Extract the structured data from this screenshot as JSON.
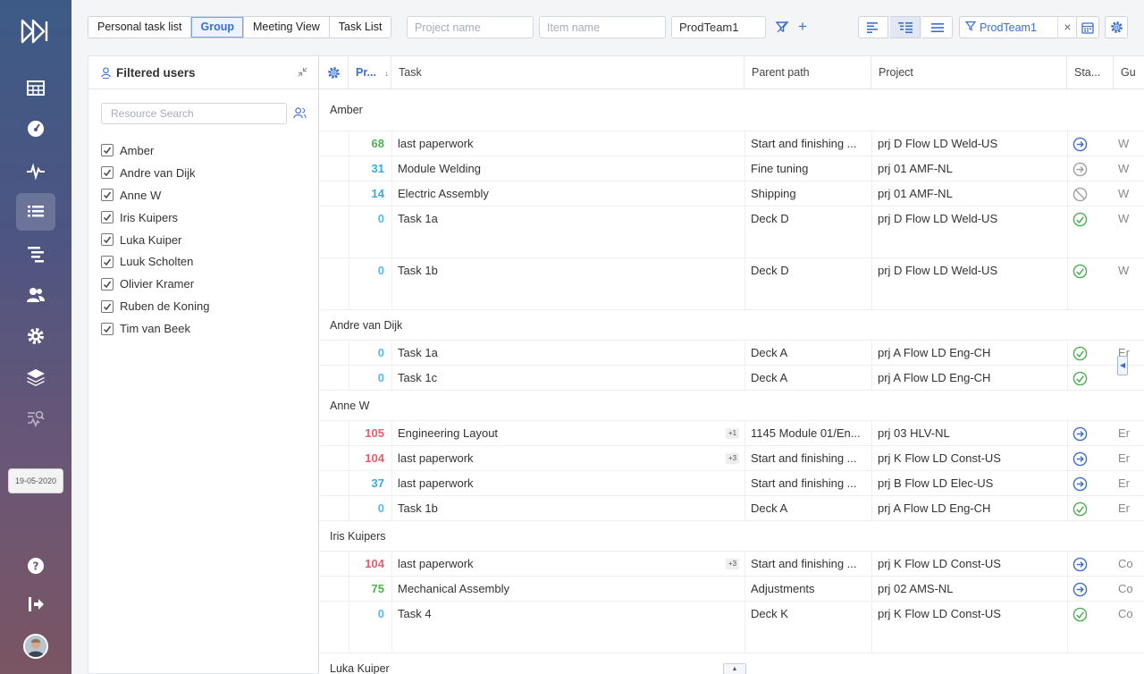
{
  "toolbar": {
    "views": [
      "Personal task list",
      "Group",
      "Meeting View",
      "Task List"
    ],
    "active_view": "Group",
    "project_placeholder": "Project name",
    "item_placeholder": "Item name",
    "team_value": "ProdTeam1",
    "filter_chip_label": "ProdTeam1",
    "close_symbol": "×",
    "add_symbol": "+"
  },
  "sidebar": {
    "date": "19-05-2020"
  },
  "users_panel": {
    "title": "Filtered users",
    "search_placeholder": "Resource Search",
    "users": [
      "Amber",
      "Andre van Dijk",
      "Anne W",
      "Iris Kuipers",
      "Luka Kuiper",
      "Luuk Scholten",
      "Olivier Kramer",
      "Ruben de Koning",
      "Tim van Beek"
    ]
  },
  "grid": {
    "columns": {
      "priority": "Pr...",
      "task": "Task",
      "parent": "Parent path",
      "project": "Project",
      "status": "Sta...",
      "group": "Gu"
    },
    "groups": [
      {
        "name": "Amber",
        "rows": [
          {
            "prio": "68",
            "prio_color": "#4caf50",
            "task": "last paperwork",
            "badge": "",
            "parent": "Start and finishing ...",
            "project": "prj D Flow LD Weld-US",
            "status": "in-progress",
            "gu": "W"
          },
          {
            "prio": "31",
            "prio_color": "#36a9e1",
            "task": "Module Welding",
            "badge": "",
            "parent": "Fine tuning",
            "project": "prj 01 AMF-NL",
            "status": "pending",
            "gu": "W"
          },
          {
            "prio": "14",
            "prio_color": "#36a9e1",
            "task": "Electric Assembly",
            "badge": "",
            "parent": "Shipping",
            "project": "prj 01 AMF-NL",
            "status": "blocked",
            "gu": "W"
          },
          {
            "prio": "0",
            "prio_color": "#5bb8ec",
            "task": "Task 1a",
            "badge": "",
            "parent": "Deck D",
            "project": "prj D Flow LD Weld-US",
            "status": "done",
            "gu": "W"
          },
          {
            "prio": "0",
            "prio_color": "#5bb8ec",
            "task": "Task 1b",
            "badge": "",
            "parent": "Deck D",
            "project": "prj D Flow LD Weld-US",
            "status": "done",
            "gu": "W"
          }
        ]
      },
      {
        "name": "Andre van Dijk",
        "rows": [
          {
            "prio": "0",
            "prio_color": "#5bb8ec",
            "task": "Task 1a",
            "badge": "",
            "parent": "Deck A",
            "project": "prj A Flow LD Eng-CH",
            "status": "done",
            "gu": "Er"
          },
          {
            "prio": "0",
            "prio_color": "#5bb8ec",
            "task": "Task 1c",
            "badge": "",
            "parent": "Deck A",
            "project": "prj A Flow LD Eng-CH",
            "status": "done",
            "gu": ""
          }
        ]
      },
      {
        "name": "Anne W",
        "rows": [
          {
            "prio": "105",
            "prio_color": "#e85c6e",
            "task": "Engineering Layout",
            "badge": "+1",
            "parent": "1145 Module 01/En...",
            "project": "prj 03 HLV-NL",
            "status": "in-progress",
            "gu": "Er"
          },
          {
            "prio": "104",
            "prio_color": "#e85c6e",
            "task": "last paperwork",
            "badge": "+3",
            "parent": "Start and finishing ...",
            "project": "prj K Flow LD Const-US",
            "status": "in-progress",
            "gu": "Er"
          },
          {
            "prio": "37",
            "prio_color": "#36a9e1",
            "task": "last paperwork",
            "badge": "",
            "parent": "Start and finishing ...",
            "project": "prj B Flow LD Elec-US",
            "status": "in-progress",
            "gu": "Er"
          },
          {
            "prio": "0",
            "prio_color": "#5bb8ec",
            "task": "Task 1b",
            "badge": "",
            "parent": "Deck A",
            "project": "prj A Flow LD Eng-CH",
            "status": "done",
            "gu": "Er"
          }
        ]
      },
      {
        "name": "Iris Kuipers",
        "rows": [
          {
            "prio": "104",
            "prio_color": "#e85c6e",
            "task": "last paperwork",
            "badge": "+3",
            "parent": "Start and finishing ...",
            "project": "prj K Flow LD Const-US",
            "status": "in-progress",
            "gu": "Co"
          },
          {
            "prio": "75",
            "prio_color": "#4caf50",
            "task": "Mechanical Assembly",
            "badge": "",
            "parent": "Adjustments",
            "project": "prj 02 AMS-NL",
            "status": "in-progress",
            "gu": "Co"
          },
          {
            "prio": "0",
            "prio_color": "#5bb8ec",
            "task": "Task 4",
            "badge": "",
            "parent": "Deck K",
            "project": "prj K Flow LD Const-US",
            "status": "done",
            "gu": "Co"
          }
        ]
      },
      {
        "name": "Luka Kuiper",
        "rows": []
      }
    ]
  },
  "colors": {
    "accent": "#3a6fd1",
    "status_in_progress": "#3a6fd1",
    "status_pending": "#9e9e9e",
    "status_done": "#4caf50"
  }
}
